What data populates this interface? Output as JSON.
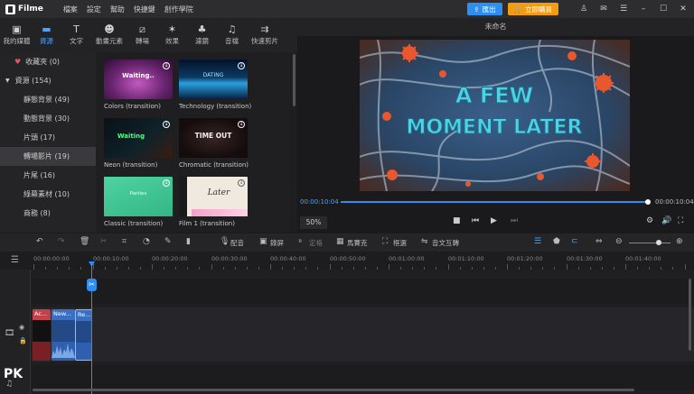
{
  "app": {
    "name": "Filme"
  },
  "menu": [
    "檔案",
    "設定",
    "幫助",
    "快捷鍵",
    "創作學院"
  ],
  "actions": {
    "export": "匯出",
    "buy": "立即購買"
  },
  "toolbar": [
    {
      "icon": "media-icon",
      "glyph": "▣",
      "label": "我的媒體"
    },
    {
      "icon": "resource-icon",
      "glyph": "▬",
      "label": "資源"
    },
    {
      "icon": "text-icon",
      "glyph": "T",
      "label": "文字"
    },
    {
      "icon": "animated-element-icon",
      "glyph": "☻",
      "label": "動畫元素"
    },
    {
      "icon": "transition-icon",
      "glyph": "⧄",
      "label": "轉場"
    },
    {
      "icon": "effects-icon",
      "glyph": "✶",
      "label": "效果"
    },
    {
      "icon": "filter-icon",
      "glyph": "♣",
      "label": "濾鏡"
    },
    {
      "icon": "music-icon",
      "glyph": "♫",
      "label": "音檔"
    },
    {
      "icon": "quick-edit-icon",
      "glyph": "⇉",
      "label": "快速剪片"
    }
  ],
  "sidebar": {
    "favorites": "收藏夾 (0)",
    "resources": "資源 (154)",
    "items": [
      {
        "label": "靜態背景 (49)"
      },
      {
        "label": "動態背景 (30)"
      },
      {
        "label": "片頭 (17)"
      },
      {
        "label": "轉場影片 (19)"
      },
      {
        "label": "片尾 (16)"
      },
      {
        "label": "綠幕素材 (10)"
      },
      {
        "label": "商務 (8)"
      }
    ]
  },
  "library": [
    {
      "label": "Colors (transition)",
      "thumb_text": "Waiting..",
      "bg": "#6a2470"
    },
    {
      "label": "Technology (transition)",
      "thumb_text": "DATING",
      "bg": "#0d3a63"
    },
    {
      "label": "Neon (transition)",
      "thumb_text": "Waiting",
      "bg": "#0c1418"
    },
    {
      "label": "Chromatic (transition)",
      "thumb_text": "TIME OUT",
      "bg": "#1e1414"
    },
    {
      "label": "Classic (transition)",
      "thumb_text": "Parties",
      "bg": "#3bbf8e"
    },
    {
      "label": "Film 1 (transition)",
      "thumb_text": "Later",
      "bg": "#e8e2d8"
    }
  ],
  "preview": {
    "title": "未命名",
    "frame_text_1": "A FEW",
    "frame_text_2": "MOMENT LATER",
    "time_current": "00:00:10:04",
    "time_total": "00:00:10:04",
    "progress": 1.0,
    "zoom": "50%"
  },
  "timeline_toolbar": {
    "voiceover": "配音",
    "record": "錄屏",
    "keyframe": "定格",
    "mosaic": "馬賽克",
    "frame": "框選",
    "tts": "音文互轉"
  },
  "ruler": [
    "00:00:00:00",
    "00:00:10:00",
    "00:00:20:00",
    "00:00:30:00",
    "00:00:40:00",
    "00:00:50:00",
    "00:01:00:00",
    "00:01:10:00",
    "00:01:20:00",
    "00:01:30:00",
    "00:01:40:00"
  ],
  "clips": [
    {
      "label": "Ac..."
    },
    {
      "label": "New..."
    },
    {
      "label": "Re..."
    }
  ],
  "watermark": "PK"
}
